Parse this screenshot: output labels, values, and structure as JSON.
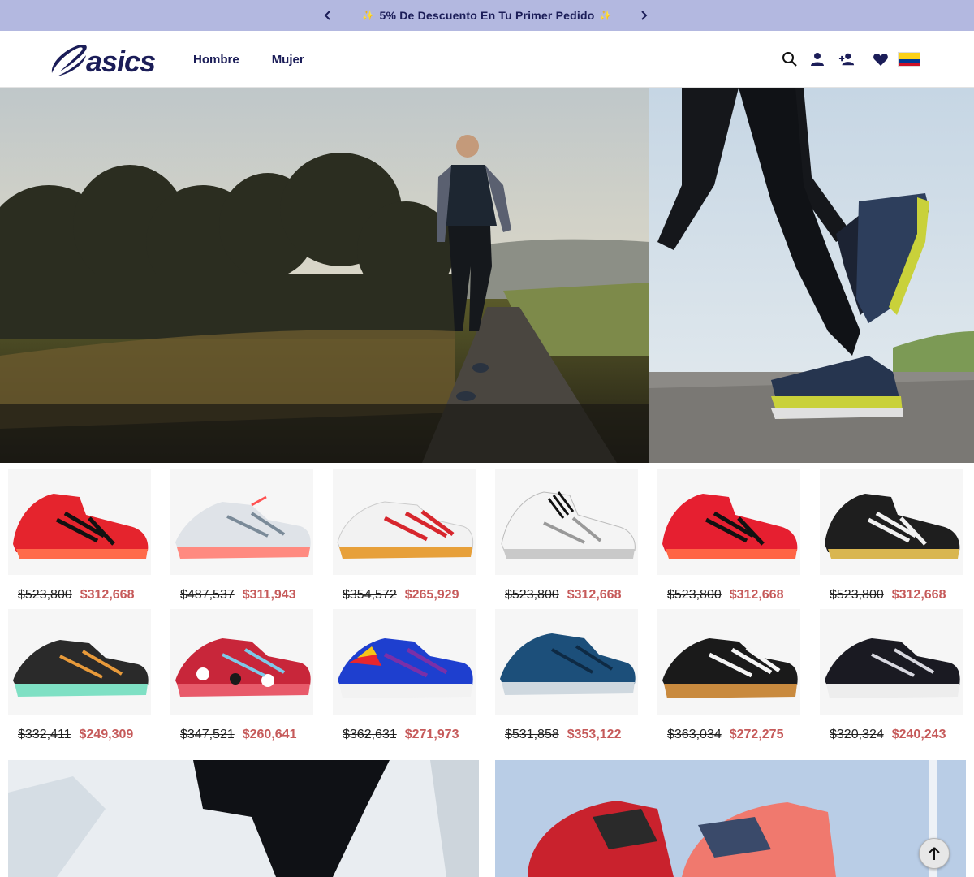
{
  "promo": {
    "text": "5% De Descuento En Tu Primer Pedido",
    "spark_icon": "✨"
  },
  "header": {
    "logo_text": "asics",
    "nav": [
      {
        "label": "Hombre"
      },
      {
        "label": "Mujer"
      }
    ],
    "icons": [
      "search-icon",
      "account-icon",
      "register-icon",
      "wishlist-icon",
      "colombia-flag-icon"
    ]
  },
  "colors": {
    "promo_bg": "#b3b8e0",
    "brand": "#1b1d58",
    "sale_price": "#c65a5a"
  },
  "products": {
    "row1": [
      {
        "name": "shoe-red-mid",
        "old_price": "$523,800",
        "new_price": "$312,668"
      },
      {
        "name": "shoe-white-coral",
        "old_price": "$487,537",
        "new_price": "$311,943"
      },
      {
        "name": "shoe-white-red",
        "old_price": "$354,572",
        "new_price": "$265,929"
      },
      {
        "name": "shoe-white-black-mid",
        "old_price": "$523,800",
        "new_price": "$312,668"
      },
      {
        "name": "shoe-red-mid-2",
        "old_price": "$523,800",
        "new_price": "$312,668"
      },
      {
        "name": "shoe-black-gold-mid",
        "old_price": "$523,800",
        "new_price": "$312,668"
      }
    ],
    "row2": [
      {
        "name": "shoe-black-mint",
        "old_price": "$332,411",
        "new_price": "$249,309"
      },
      {
        "name": "shoe-red-camo",
        "old_price": "$347,521",
        "new_price": "$260,641"
      },
      {
        "name": "shoe-blue-purple",
        "old_price": "$362,631",
        "new_price": "$271,973"
      },
      {
        "name": "shoe-navy-blue",
        "old_price": "$531,858",
        "new_price": "$353,122"
      },
      {
        "name": "shoe-black-white-gum",
        "old_price": "$363,034",
        "new_price": "$272,275"
      },
      {
        "name": "shoe-black-white",
        "old_price": "$320,324",
        "new_price": "$240,243"
      }
    ]
  }
}
